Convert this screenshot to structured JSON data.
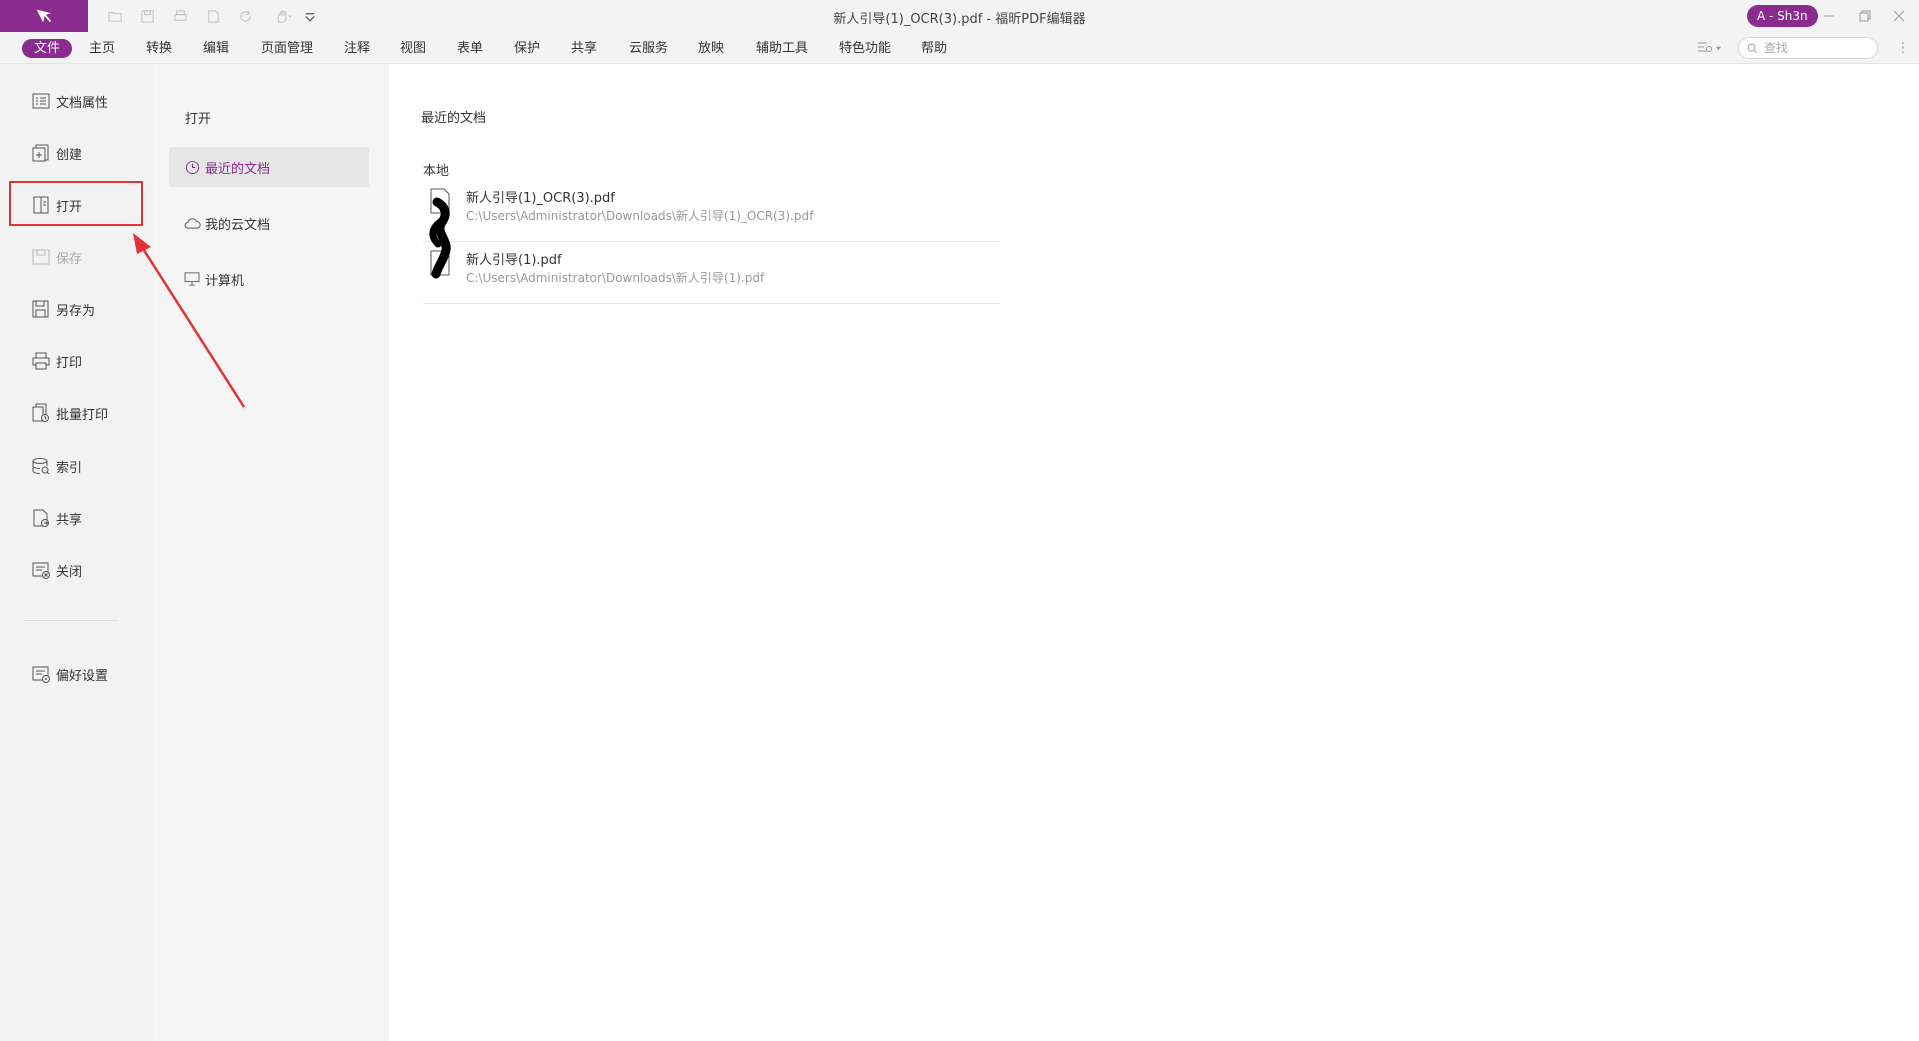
{
  "window": {
    "title": "新人引导(1)_OCR(3).pdf - 福昕PDF编辑器",
    "user": "A - Sh3n"
  },
  "quick_access": [
    "open-folder-icon",
    "save-icon",
    "print-icon",
    "new-file-icon",
    "redo-icon",
    "hand-tool-icon",
    "customize-dropdown-icon"
  ],
  "menu": {
    "items": [
      "文件",
      "主页",
      "转换",
      "编辑",
      "页面管理",
      "注释",
      "视图",
      "表单",
      "保护",
      "共享",
      "云服务",
      "放映",
      "辅助工具",
      "特色功能",
      "帮助"
    ],
    "active_index": 0
  },
  "search": {
    "placeholder": "查找"
  },
  "leftnav": {
    "items": [
      {
        "label": "文档属性",
        "icon": "document-properties-icon",
        "enabled": true
      },
      {
        "label": "创建",
        "icon": "create-icon",
        "enabled": true
      },
      {
        "label": "打开",
        "icon": "open-icon",
        "enabled": true
      },
      {
        "label": "保存",
        "icon": "save-icon",
        "enabled": false
      },
      {
        "label": "另存为",
        "icon": "save-as-icon",
        "enabled": true
      },
      {
        "label": "打印",
        "icon": "print-icon",
        "enabled": true
      },
      {
        "label": "批量打印",
        "icon": "batch-print-icon",
        "enabled": true
      },
      {
        "label": "索引",
        "icon": "index-icon",
        "enabled": true
      },
      {
        "label": "共享",
        "icon": "share-icon",
        "enabled": true
      },
      {
        "label": "关闭",
        "icon": "close-doc-icon",
        "enabled": true
      }
    ],
    "preferences": {
      "label": "偏好设置",
      "icon": "preferences-icon"
    },
    "selected_index": 2
  },
  "open_panel": {
    "title": "打开",
    "items": [
      {
        "label": "最近的文档",
        "icon": "clock-icon",
        "selected": true
      },
      {
        "label": "我的云文档",
        "icon": "cloud-icon",
        "selected": false
      },
      {
        "label": "计算机",
        "icon": "computer-icon",
        "selected": false
      }
    ]
  },
  "recent": {
    "title": "最近的文档",
    "section": "本地",
    "documents": [
      {
        "name": "新人引导(1)_OCR(3).pdf",
        "path": "C:\\Users\\Administrator\\Downloads\\新人引导(1)_OCR(3).pdf"
      },
      {
        "name": "新人引导(1).pdf",
        "path": "C:\\Users\\Administrator\\Downloads\\新人引导(1).pdf"
      }
    ]
  },
  "colors": {
    "accent": "#8b2b8f",
    "annotation": "#e0343a"
  }
}
